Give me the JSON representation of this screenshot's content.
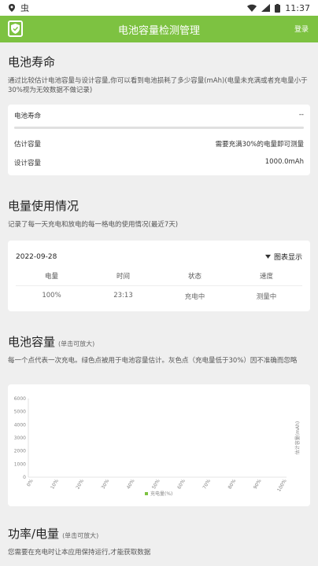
{
  "status_bar": {
    "time": "11:37",
    "app_glyph": "虫"
  },
  "app_bar": {
    "title": "电池容量检测管理",
    "login": "登录"
  },
  "battery_life": {
    "title": "电池寿命",
    "description": "通过比较估计电池容量与设计容量,你可以看到电池损耗了多少容量(mAh)(电量未充满或者充电量小于30%视为无效数据不做记录)",
    "card": {
      "label": "电池寿命",
      "value": "--",
      "progress": 0,
      "estimated_label": "估计容量",
      "estimated_value": "需要充满30%的电量即可测量",
      "design_label": "设计容量",
      "design_value": "1000.0mAh"
    }
  },
  "usage": {
    "title": "电量使用情况",
    "description": "记录了每一天充电和放电的每一格电的使用情况(最近7天)",
    "date": "2022-09-28",
    "view_label": "图表显示",
    "columns": [
      "电量",
      "时间",
      "状态",
      "速度"
    ],
    "rows": [
      [
        "100%",
        "23:13",
        "充电中",
        "测量中"
      ]
    ]
  },
  "capacity": {
    "title": "电池容量",
    "hint": "(单击可放大)",
    "description": "每一个点代表一次充电。绿色点被用于电池容量估计。灰色点（充电量低于30%）因不准确而忽略"
  },
  "power": {
    "title": "功率/电量",
    "hint": "(单击可放大)",
    "description": "您需要在充电时让本应用保持运行,才能获取数据"
  },
  "chart_data": {
    "type": "scatter",
    "x_ticks": [
      "0%",
      "10%",
      "20%",
      "30%",
      "40%",
      "50%",
      "60%",
      "70%",
      "80%",
      "90%",
      "100%"
    ],
    "y_ticks": [
      "0",
      "1000",
      "2000",
      "3000",
      "4000",
      "5000",
      "6000"
    ],
    "ylim": [
      0,
      6000
    ],
    "xlabel": "",
    "ylabel": "估计容量(mAh)",
    "legend": [
      {
        "name": "充电量(%)",
        "position": "bottom-center"
      }
    ],
    "series": [],
    "grid": false,
    "colors": {
      "legend_swatch": "#7dc241"
    }
  },
  "colors": {
    "accent": "#7dc241",
    "background": "#efefef"
  }
}
